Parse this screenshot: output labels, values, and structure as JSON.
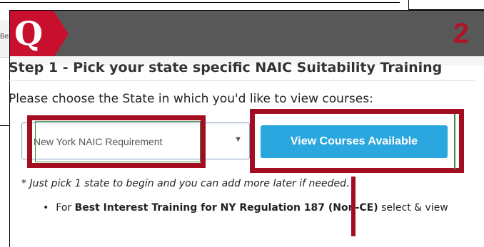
{
  "background": {
    "strip_text": "Bes"
  },
  "header": {
    "logo_letter": "Q",
    "step_number": "2"
  },
  "section": {
    "title": "Step 1 - Pick your state specific NAIC Suitability Training",
    "prompt": "Please choose the State in which you'd like to view courses:"
  },
  "state_select": {
    "selected_value": "New York NAIC Requirement",
    "arrow": "▼"
  },
  "view_button": {
    "label": "View Courses Available"
  },
  "note": {
    "text": "* Just pick 1 state to begin and you can add more later if needed."
  },
  "bullet": {
    "dot": "•",
    "prefix": "For ",
    "bold_text": "Best Interest Training for NY Regulation 187 (Non-CE)",
    "suffix": " select & view"
  },
  "colors": {
    "brand_red": "#c8102e",
    "header_gray": "#585858",
    "button_blue": "#2aa7de",
    "highlight_red": "#a30d22"
  }
}
